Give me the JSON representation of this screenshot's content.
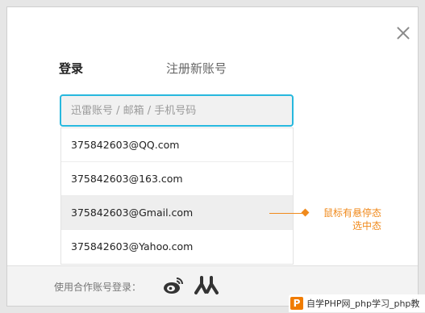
{
  "dialog": {
    "tabs": [
      {
        "label": "登录",
        "active": true
      },
      {
        "label": "注册新账号",
        "active": false
      }
    ],
    "account_input": {
      "value": "",
      "placeholder": "迅雷账号 / 邮箱 / 手机号码"
    },
    "suggestions": [
      "375842603@QQ.com",
      "375842603@163.com",
      "375842603@Gmail.com",
      "375842603@Yahoo.com"
    ],
    "hovered_suggestion_index": 2,
    "annotation": {
      "line1": "鼠标有悬停态",
      "line2": "选中态",
      "color": "#f08a1c"
    },
    "footer": {
      "label": "使用合作账号登录："
    },
    "accent_color": "#27b8de"
  },
  "watermark": {
    "logo": "P",
    "text": "自学PHP网_php学习_php教"
  }
}
